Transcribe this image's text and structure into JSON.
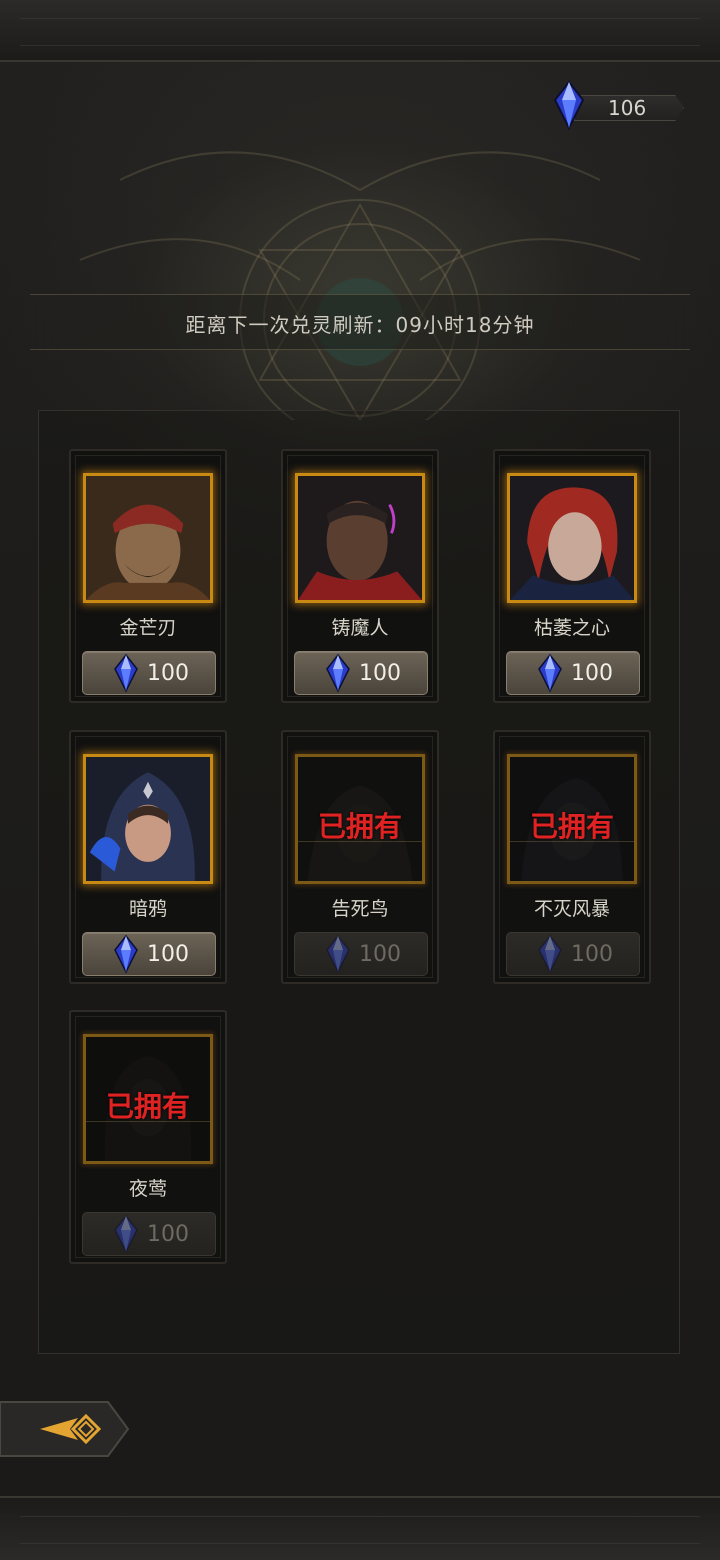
{
  "currency": {
    "amount": "106",
    "icon": "blue-crystal-icon"
  },
  "timer": {
    "text": "距离下一次兑灵刷新：09小时18分钟"
  },
  "cards": [
    {
      "name": "金芒刃",
      "price": "100",
      "owned": false,
      "owned_label": ""
    },
    {
      "name": "铸魔人",
      "price": "100",
      "owned": false,
      "owned_label": ""
    },
    {
      "name": "枯萎之心",
      "price": "100",
      "owned": false,
      "owned_label": ""
    },
    {
      "name": "暗鸦",
      "price": "100",
      "owned": false,
      "owned_label": ""
    },
    {
      "name": "告死鸟",
      "price": "100",
      "owned": true,
      "owned_label": "已拥有"
    },
    {
      "name": "不灭风暴",
      "price": "100",
      "owned": true,
      "owned_label": "已拥有"
    },
    {
      "name": "夜莺",
      "price": "100",
      "owned": true,
      "owned_label": "已拥有"
    }
  ],
  "back_button": {
    "icon": "back-arrow-icon"
  },
  "colors": {
    "owned_text": "#e02222",
    "frame_gold": "#c88a12",
    "gem_blue": "#3a5cff"
  }
}
